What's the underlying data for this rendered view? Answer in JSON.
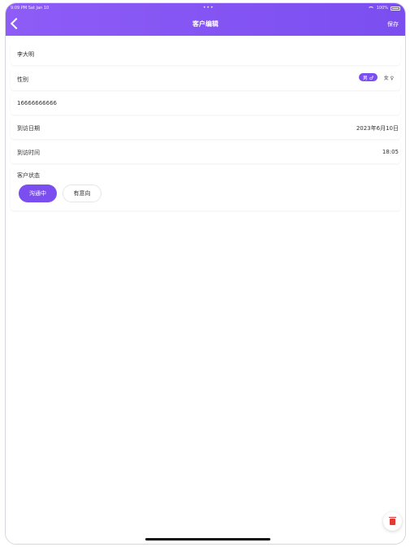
{
  "status_bar": {
    "time": "9:09 PM  Sat Jan 10",
    "dots": "•••",
    "battery": "100%"
  },
  "nav": {
    "title": "客户编辑",
    "save_label": "保存"
  },
  "form": {
    "name_value": "李大明",
    "gender_label": "性别",
    "gender_male": "男 ♂",
    "gender_female": "女 ♀",
    "phone_value": "16666666666",
    "visit_date_label": "到访日期",
    "visit_date_value": "2023年6月10日",
    "visit_time_label": "到访时间",
    "visit_time_value": "18:05",
    "customer_status_label": "客户状态",
    "status_options": [
      "沟通中",
      "有意向"
    ],
    "selected_status": "沟通中"
  },
  "colors": {
    "accent": "#7b4ef0",
    "delete": "#e53935"
  },
  "icons": {
    "back": "chevron-left-icon",
    "delete": "trash-icon"
  }
}
